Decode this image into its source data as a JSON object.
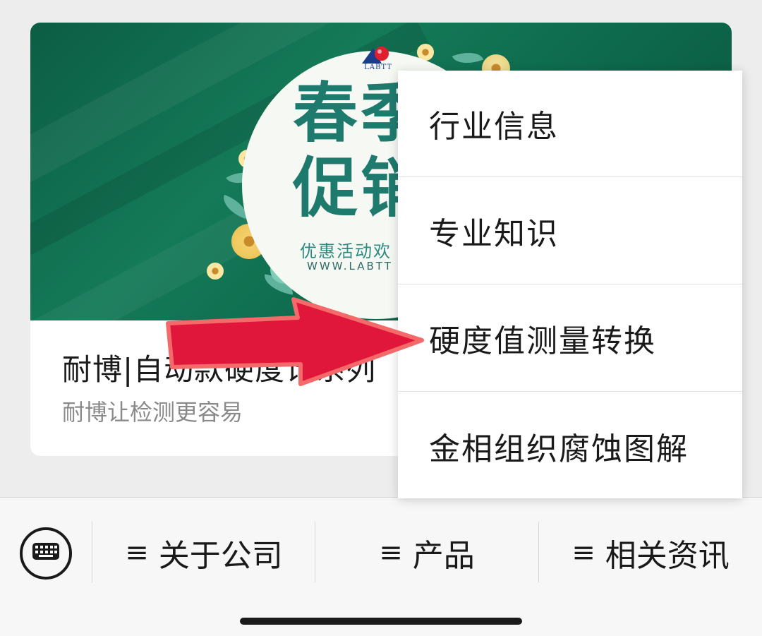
{
  "card": {
    "banner": {
      "logo_text": "LABTT",
      "headline_line1": "春季",
      "headline_line2": "促销",
      "subtitle": "优惠活动欢",
      "url": "WWW.LABTT"
    },
    "title": "耐博|自动款硬度计系列",
    "source": "耐博让检测更容易"
  },
  "popup_menu": {
    "items": [
      {
        "label": "行业信息"
      },
      {
        "label": "专业知识"
      },
      {
        "label": "硬度值测量转换"
      },
      {
        "label": "金相组织腐蚀图解"
      }
    ]
  },
  "bottom_menu": {
    "keyboard_icon": "keyboard-icon",
    "items": [
      {
        "icon": "≡",
        "label": "关于公司"
      },
      {
        "icon": "≡",
        "label": "产品"
      },
      {
        "icon": "≡",
        "label": "相关资讯"
      }
    ]
  },
  "colors": {
    "banner_green": "#0e6a4d",
    "annotation_arrow": "#e0173a"
  }
}
